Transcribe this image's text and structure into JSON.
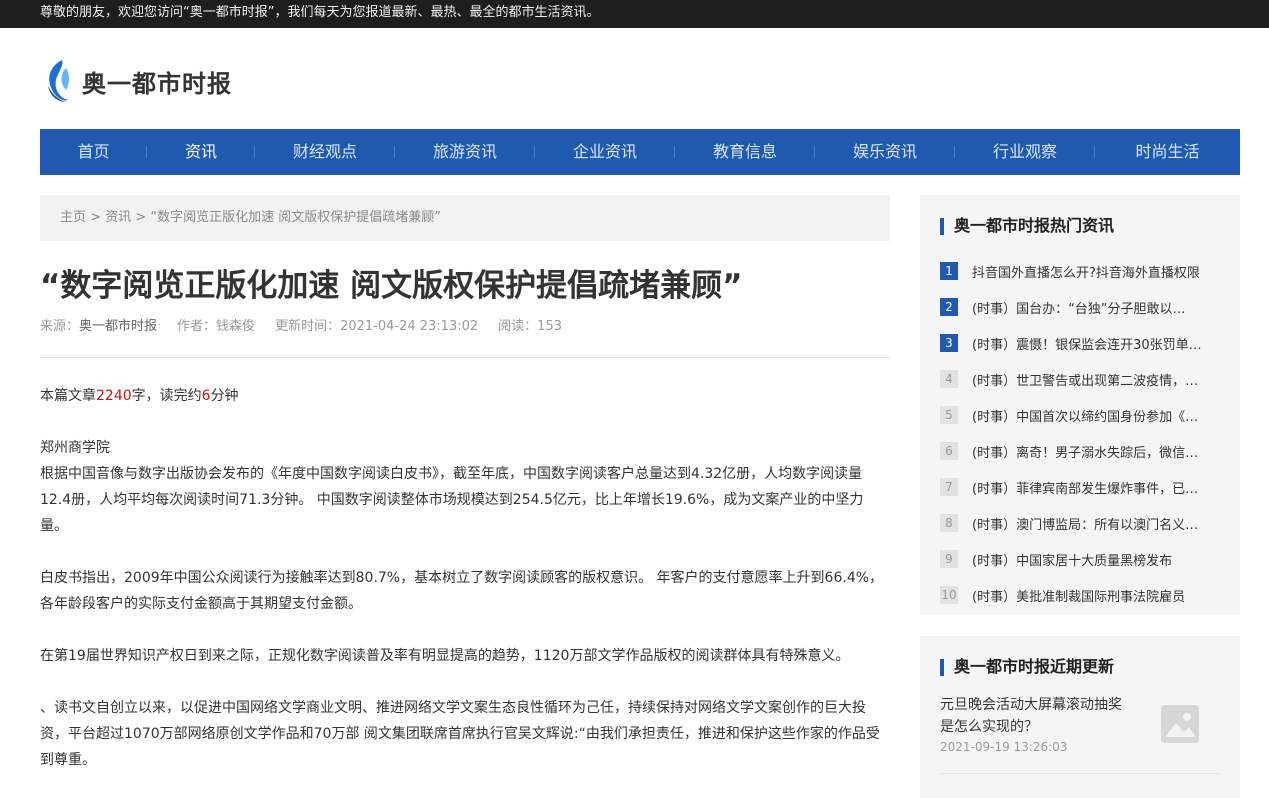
{
  "topbar": {
    "welcome": "尊敬的朋友，欢迎您访问“奥一都市时报”，我们每天为您报道最新、最热、最全的都市生活资讯。"
  },
  "brand": {
    "name": "奥一都市时报",
    "logo_icon": "swirl-logo-icon",
    "accent_color": "#1f5ab0"
  },
  "nav": {
    "items": [
      {
        "label": "首页",
        "active": false
      },
      {
        "label": "资讯",
        "active": true
      },
      {
        "label": "财经观点",
        "active": false
      },
      {
        "label": "旅游资讯",
        "active": false
      },
      {
        "label": "企业资讯",
        "active": false
      },
      {
        "label": "教育信息",
        "active": false
      },
      {
        "label": "娱乐资讯",
        "active": false
      },
      {
        "label": "行业观察",
        "active": false
      },
      {
        "label": "时尚生活",
        "active": false
      }
    ]
  },
  "breadcrumb": {
    "home": "主页",
    "sep1": ">",
    "section": "资讯",
    "sep2": ">",
    "current": "“数字阅览正版化加速 阅文版权保护提倡疏堵兼顾”"
  },
  "article": {
    "title": "“数字阅览正版化加速 阅文版权保护提倡疏堵兼顾”",
    "meta": {
      "source_label": "来源：",
      "source": "奥一都市时报",
      "author_label": "作者：",
      "author": "钱森俊",
      "time_label": "更新时间：",
      "time": "2021-04-24 23:13:02",
      "views_label": "阅读：",
      "views": "153"
    },
    "reading": {
      "prefix": "本篇文章",
      "chars": "2240",
      "mid": "字，读完约",
      "minutes": "6",
      "suffix": "分钟"
    },
    "paragraphs": [
      "郑州商学院",
      "根据中国音像与数字出版协会发布的《年度中国数字阅读白皮书》，截至年底，中国数字阅读客户总量达到4.32亿册，人均数字阅读量12.4册，人均平均每次阅读时间71.3分钟。 中国数字阅读整体市场规模达到254.5亿元，比上年增长19.6%，成为文案产业的中坚力量。",
      "白皮书指出，2009年中国公众阅读行为接触率达到80.7%，基本树立了数字阅读顾客的版权意识。 年客户的支付意愿率上升到66.4%，各年龄段客户的实际支付金额高于其期望支付金额。",
      "在第19届世界知识产权日到来之际，正规化数字阅读普及率有明显提高的趋势，1120万部文学作品版权的阅读群体具有特殊意义。",
      "、读书文自创立以来，以促进中国网络文学商业文明、推进网络文学文案生态良性循环为己任，持续保持对网络文学文案创作的巨大投资，平台超过1070万部网络原创文学作品和70万部 阅文集团联席首席执行官吴文辉说:“由我们承担责任，推进和保护这些作家的作品受到尊重。"
    ]
  },
  "sidebar": {
    "hot": {
      "title": "奥一都市时报热门资讯",
      "items": [
        {
          "rank": "1",
          "text": "抖音国外直播怎么开?抖音海外直播权限"
        },
        {
          "rank": "2",
          "text": "(时事）国台办：“台独”分子胆敢以…"
        },
        {
          "rank": "3",
          "text": "(时事）震慑！银保监会连开30张罚单…"
        },
        {
          "rank": "4",
          "text": "(时事）世卫警告或出现第二波疫情，…"
        },
        {
          "rank": "5",
          "text": "(时事）中国首次以缔约国身份参加《…"
        },
        {
          "rank": "6",
          "text": "(时事）离奇！男子溺水失踪后，微信…"
        },
        {
          "rank": "7",
          "text": "(时事）菲律宾南部发生爆炸事件，已…"
        },
        {
          "rank": "8",
          "text": "(时事）澳门博监局：所有以澳门名义…"
        },
        {
          "rank": "9",
          "text": "(时事）中国家居十大质量黑榜发布"
        },
        {
          "rank": "10",
          "text": "(时事）美批准制裁国际刑事法院雇员"
        }
      ]
    },
    "recent": {
      "title": "奥一都市时报近期更新",
      "items": [
        {
          "title": "元旦晚会活动大屏幕滚动抽奖是怎么实现的？",
          "date": "2021-09-19 13:26:03",
          "thumb_icon": "image-placeholder-icon"
        }
      ]
    }
  }
}
